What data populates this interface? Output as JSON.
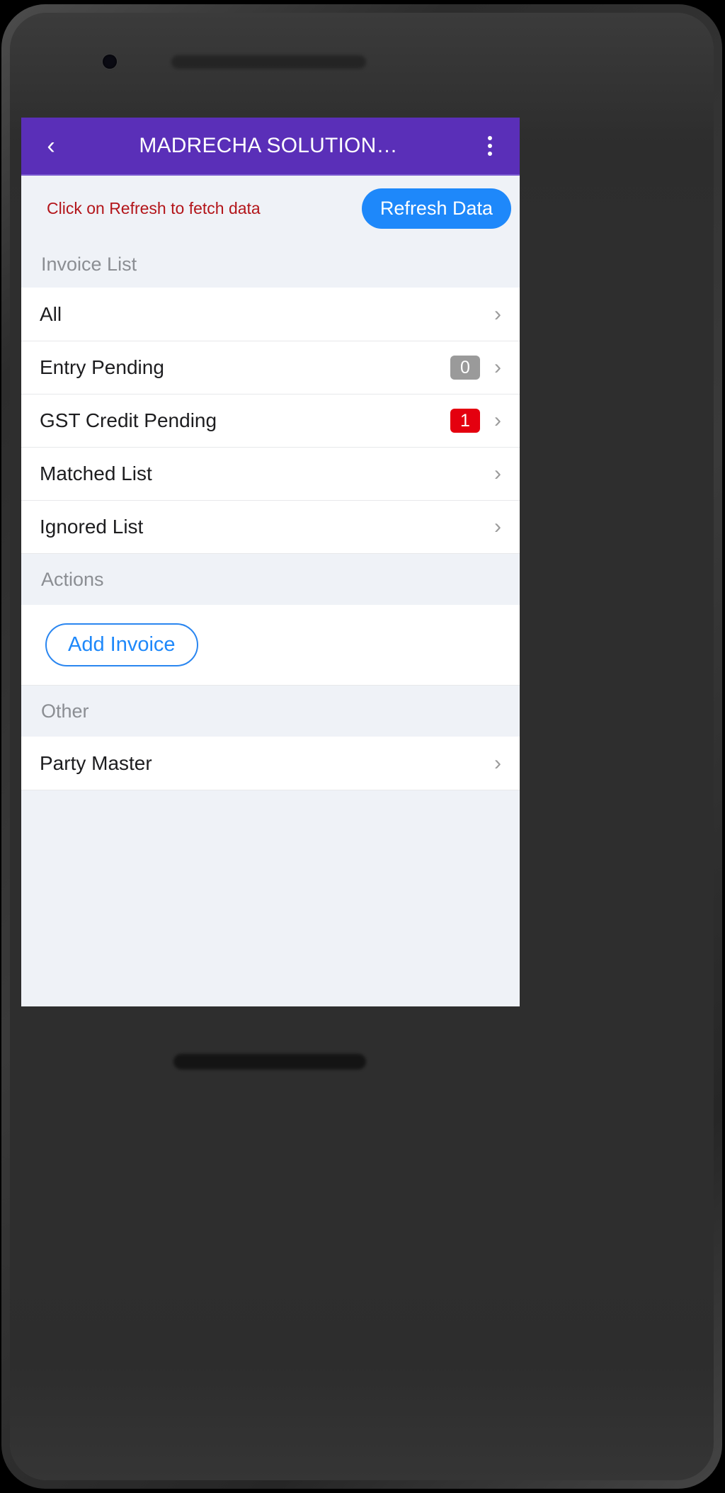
{
  "appbar": {
    "back_icon": "chevron-left-icon",
    "title": "MADRECHA SOLUTION…",
    "menu_icon": "overflow-menu-icon",
    "color": "#5a2fb8"
  },
  "banner": {
    "message": "Click on Refresh to fetch data",
    "message_color": "#b3151a",
    "refresh_label": "Refresh Data",
    "refresh_color": "#1e88fa"
  },
  "sections": {
    "invoice_list": {
      "header": "Invoice List",
      "rows": [
        {
          "label": "All",
          "badge": null,
          "badge_type": null,
          "chevron": "chevron-right-icon"
        },
        {
          "label": "Entry Pending",
          "badge": "0",
          "badge_type": "gray",
          "chevron": "chevron-right-icon"
        },
        {
          "label": "GST Credit Pending",
          "badge": "1",
          "badge_type": "red",
          "chevron": "chevron-right-icon"
        },
        {
          "label": "Matched List",
          "badge": null,
          "badge_type": null,
          "chevron": "chevron-right-icon"
        },
        {
          "label": "Ignored List",
          "badge": null,
          "badge_type": null,
          "chevron": "chevron-right-icon"
        }
      ]
    },
    "actions": {
      "header": "Actions",
      "add_invoice_label": "Add Invoice"
    },
    "other": {
      "header": "Other",
      "rows": [
        {
          "label": "Party Master",
          "badge": null,
          "badge_type": null,
          "chevron": "chevron-right-icon"
        }
      ]
    }
  },
  "badge_colors": {
    "gray": "#9a9a9a",
    "red": "#e4000f"
  }
}
